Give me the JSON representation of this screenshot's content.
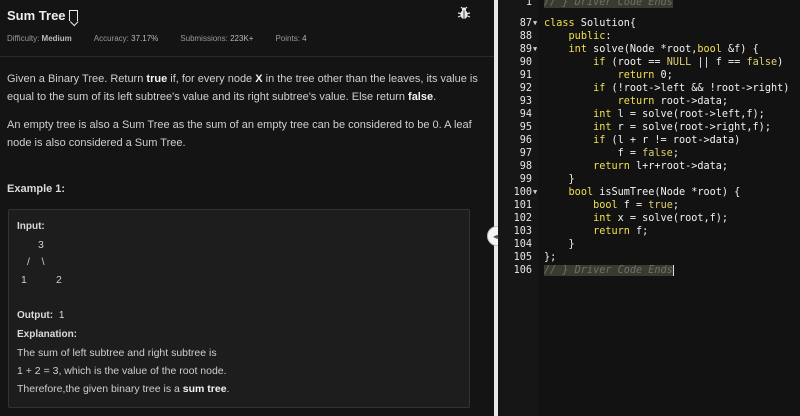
{
  "problem": {
    "title": "Sum Tree",
    "meta": [
      {
        "label": "Difficulty:",
        "value": "Medium"
      },
      {
        "label": "Accuracy:",
        "value": "37.17%"
      },
      {
        "label": "Submissions:",
        "value": "223K+"
      },
      {
        "label": "Points:",
        "value": "4"
      }
    ],
    "desc1_a": "Given a Binary Tree. Return ",
    "desc1_true": "true",
    "desc1_b": " if, for every node ",
    "desc1_x": "X",
    "desc1_c": " in the tree other than the leaves, its value is equal to the sum of its left subtree's value and its right subtree's value. Else return ",
    "desc1_false": "false",
    "desc1_d": ".",
    "desc2": "An empty tree is also a Sum Tree as the sum of an empty tree can be considered to be 0. A leaf node is also considered a Sum Tree.",
    "example_title": "Example 1:",
    "input_label": "Input:",
    "tree_root": "3",
    "tree_edges": "/    \\",
    "tree_left": "1",
    "tree_right": "2",
    "output_label": "Output:",
    "output_value": "1",
    "explanation_label": "Explanation:",
    "expl1": "The  sum  of  left  subtree  and  right  subtree  is",
    "expl2": "1  +  2  =  3,  which  is  the  value  of  the  root  node.",
    "expl3_a": "Therefore,the  given  binary  tree  is  a  ",
    "expl3_b": "sum  tree",
    "expl3_c": "."
  },
  "editor": {
    "lines": [
      {
        "n": "1",
        "text": "// } Driver Code Ends",
        "type": "comment-top"
      },
      {
        "n": "87",
        "text": "class Solution{",
        "fold": true
      },
      {
        "n": "88",
        "text": "    public:"
      },
      {
        "n": "89",
        "text": "    int solve(Node *root,bool &f) {",
        "fold": true
      },
      {
        "n": "90",
        "text": "        if (root == NULL || f == false)"
      },
      {
        "n": "91",
        "text": "            return 0;"
      },
      {
        "n": "92",
        "text": "        if (!root->left && !root->right)"
      },
      {
        "n": "93",
        "text": "            return root->data;"
      },
      {
        "n": "94",
        "text": "        int l = solve(root->left,f);"
      },
      {
        "n": "95",
        "text": "        int r = solve(root->right,f);"
      },
      {
        "n": "96",
        "text": "        if (l + r != root->data)"
      },
      {
        "n": "97",
        "text": "            f = false;"
      },
      {
        "n": "98",
        "text": "        return l+r+root->data;"
      },
      {
        "n": "99",
        "text": "    }"
      },
      {
        "n": "100",
        "text": "    bool isSumTree(Node *root) {",
        "fold": true
      },
      {
        "n": "101",
        "text": "        bool f = true;"
      },
      {
        "n": "102",
        "text": "        int x = solve(root,f);"
      },
      {
        "n": "103",
        "text": "        return f;"
      },
      {
        "n": "104",
        "text": "    }"
      },
      {
        "n": "105",
        "text": "};"
      },
      {
        "n": "106",
        "text": "// } Driver Code Ends",
        "type": "comment"
      }
    ]
  }
}
